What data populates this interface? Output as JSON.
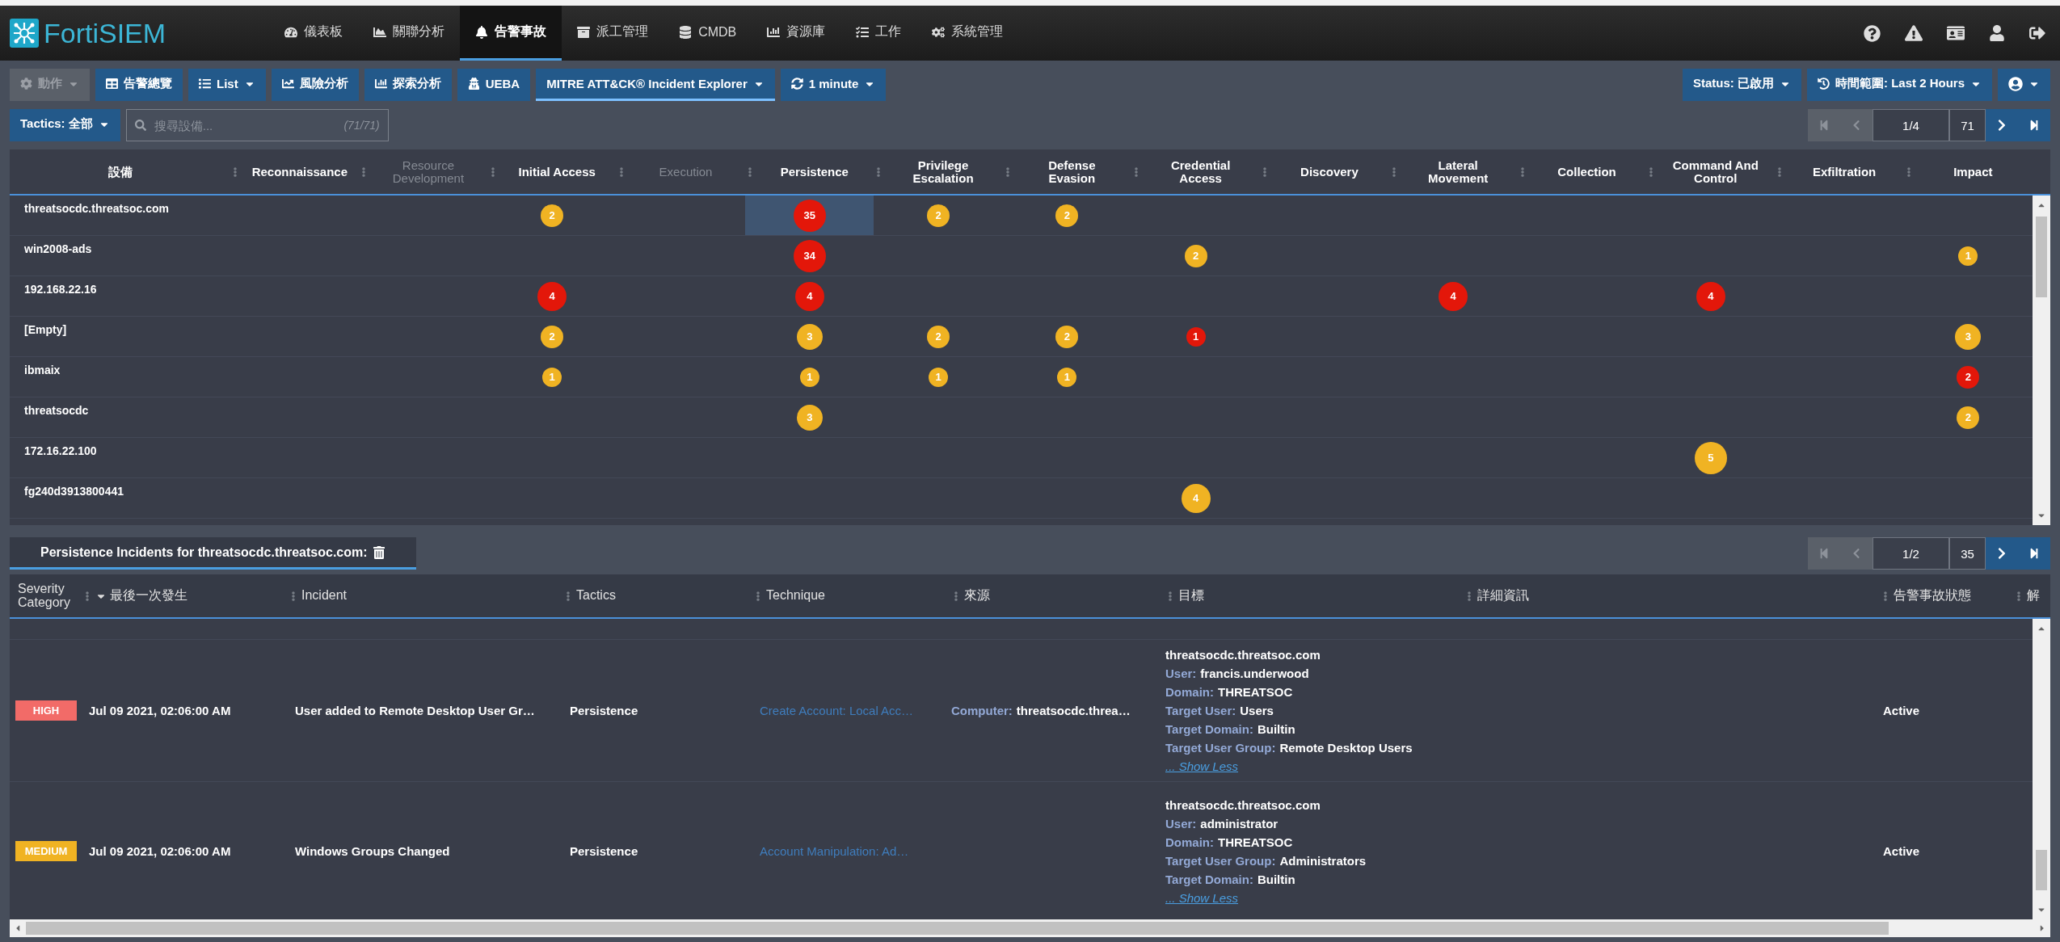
{
  "brand": "FortiSIEM",
  "nav": {
    "items": [
      {
        "label": "儀表板",
        "selected": false
      },
      {
        "label": "關聯分析",
        "selected": false
      },
      {
        "label": "告警事故",
        "selected": true
      },
      {
        "label": "派工管理",
        "selected": false
      },
      {
        "label": "CMDB",
        "selected": false
      },
      {
        "label": "資源庫",
        "selected": false
      },
      {
        "label": "工作",
        "selected": false
      },
      {
        "label": "系統管理",
        "selected": false
      }
    ]
  },
  "toolbar": {
    "left": [
      {
        "label": "動作",
        "caret": true,
        "disabled": true,
        "selected": false
      },
      {
        "label": "告警總覽",
        "caret": false,
        "disabled": false,
        "selected": false
      },
      {
        "label": "List",
        "caret": true,
        "disabled": false,
        "selected": false
      },
      {
        "label": "風險分析",
        "caret": false,
        "disabled": false,
        "selected": false
      },
      {
        "label": "探索分析",
        "caret": false,
        "disabled": false,
        "selected": false
      },
      {
        "label": "UEBA",
        "caret": false,
        "disabled": false,
        "selected": false
      },
      {
        "label": "MITRE ATT&CK® Incident Explorer",
        "caret": true,
        "disabled": false,
        "selected": true
      },
      {
        "label": "1 minute",
        "caret": true,
        "disabled": false,
        "selected": false
      }
    ],
    "right": [
      {
        "label": "Status: 已啟用",
        "caret": true
      },
      {
        "label": "時間範圍: Last 2 Hours",
        "caret": true
      },
      {
        "caret": true
      }
    ]
  },
  "filter": {
    "tactics": {
      "label": "Tactics: 全部",
      "caret": true
    },
    "search": {
      "placeholder": "搜尋設備...",
      "count": "(71/71)"
    }
  },
  "matrix_pager": {
    "page": "1/4",
    "size": "71",
    "at_start": true,
    "at_end": false
  },
  "matrix": {
    "device_column": {
      "label": "設備"
    },
    "columns": [
      {
        "label": "Reconnaissance",
        "disabled": false
      },
      {
        "label": "Resource Development",
        "disabled": true
      },
      {
        "label": "Initial Access",
        "disabled": false
      },
      {
        "label": "Execution",
        "disabled": true
      },
      {
        "label": "Persistence",
        "disabled": false
      },
      {
        "label": "Privilege Escalation",
        "disabled": false
      },
      {
        "label": "Defense Evasion",
        "disabled": false
      },
      {
        "label": "Credential Access",
        "disabled": false
      },
      {
        "label": "Discovery",
        "disabled": false
      },
      {
        "label": "Lateral Movement",
        "disabled": false
      },
      {
        "label": "Collection",
        "disabled": false
      },
      {
        "label": "Command And Control",
        "disabled": false
      },
      {
        "label": "Exfiltration",
        "disabled": false
      },
      {
        "label": "Impact",
        "disabled": false
      }
    ],
    "rows": [
      {
        "device": "threatsocdc.threatsoc.com",
        "cells": [
          null,
          null,
          {
            "count": "2",
            "color": "#f0b323",
            "selected": false
          },
          null,
          {
            "count": "35",
            "color": "#e3170a",
            "selected": true
          },
          {
            "count": "2",
            "color": "#f0b323",
            "selected": false
          },
          {
            "count": "2",
            "color": "#f0b323",
            "selected": false
          },
          null,
          null,
          null,
          null,
          null,
          null,
          null
        ]
      },
      {
        "device": "win2008-ads",
        "cells": [
          null,
          null,
          null,
          null,
          {
            "count": "34",
            "color": "#e3170a",
            "selected": false
          },
          null,
          null,
          {
            "count": "2",
            "color": "#f0b323",
            "selected": false
          },
          null,
          null,
          null,
          null,
          null,
          {
            "count": "1",
            "color": "#f0b323",
            "selected": false
          }
        ]
      },
      {
        "device": "192.168.22.16",
        "cells": [
          null,
          null,
          {
            "count": "4",
            "color": "#e3170a",
            "selected": false
          },
          null,
          {
            "count": "4",
            "color": "#e3170a",
            "selected": false
          },
          null,
          null,
          null,
          null,
          {
            "count": "4",
            "color": "#e3170a",
            "selected": false
          },
          null,
          {
            "count": "4",
            "color": "#e3170a",
            "selected": false
          },
          null,
          null
        ]
      },
      {
        "device": "[Empty]",
        "cells": [
          null,
          null,
          {
            "count": "2",
            "color": "#f0b323",
            "selected": false
          },
          null,
          {
            "count": "3",
            "color": "#f0b323",
            "selected": false
          },
          {
            "count": "2",
            "color": "#f0b323",
            "selected": false
          },
          {
            "count": "2",
            "color": "#f0b323",
            "selected": false
          },
          {
            "count": "1",
            "color": "#e3170a",
            "selected": false
          },
          null,
          null,
          null,
          null,
          null,
          {
            "count": "3",
            "color": "#f0b323",
            "selected": false
          }
        ]
      },
      {
        "device": "ibmaix",
        "cells": [
          null,
          null,
          {
            "count": "1",
            "color": "#f0b323",
            "selected": false
          },
          null,
          {
            "count": "1",
            "color": "#f0b323",
            "selected": false
          },
          {
            "count": "1",
            "color": "#f0b323",
            "selected": false
          },
          {
            "count": "1",
            "color": "#f0b323",
            "selected": false
          },
          null,
          null,
          null,
          null,
          null,
          null,
          {
            "count": "2",
            "color": "#e3170a",
            "selected": false
          }
        ]
      },
      {
        "device": "threatsocdc",
        "cells": [
          null,
          null,
          null,
          null,
          {
            "count": "3",
            "color": "#f0b323",
            "selected": false
          },
          null,
          null,
          null,
          null,
          null,
          null,
          null,
          null,
          {
            "count": "2",
            "color": "#f0b323",
            "selected": false
          }
        ]
      },
      {
        "device": "172.16.22.100",
        "cells": [
          null,
          null,
          null,
          null,
          null,
          null,
          null,
          null,
          null,
          null,
          null,
          {
            "count": "5",
            "color": "#f0b323",
            "selected": false
          },
          null,
          null
        ]
      },
      {
        "device": "fg240d3913800441",
        "cells": [
          null,
          null,
          null,
          null,
          null,
          null,
          null,
          {
            "count": "4",
            "color": "#f0b323",
            "selected": false
          },
          null,
          null,
          null,
          null,
          null,
          null
        ]
      }
    ]
  },
  "incidents": {
    "tab": {
      "label": "Persistence Incidents for threatsocdc.threatsoc.com:",
      "selected": true
    },
    "pager": {
      "page": "1/2",
      "size": "35",
      "at_start": true,
      "at_end": false
    },
    "columns": [
      {
        "label": "Severity Category",
        "sorted": false
      },
      {
        "label": "最後一次發生",
        "sorted": true
      },
      {
        "label": "Incident",
        "sorted": false
      },
      {
        "label": "Tactics",
        "sorted": false
      },
      {
        "label": "Technique",
        "sorted": false
      },
      {
        "label": "來源",
        "sorted": false
      },
      {
        "label": "目標",
        "sorted": false
      },
      {
        "label": "詳細資訊",
        "sorted": false
      },
      {
        "label": "告警事故狀態",
        "sorted": false
      },
      {
        "label": "解",
        "sorted": false
      }
    ],
    "rows": [
      {
        "severity": {
          "label": "HIGH",
          "color": "#f26b68"
        },
        "last_seen": "Jul 09 2021, 02:06:00 AM",
        "incident": "User added to Remote Desktop User Gr…",
        "tactic": "Persistence",
        "technique": "Create Account: Local Acc…",
        "source": [
          {
            "key": "Computer:",
            "value": "threatsocdc.threa…"
          }
        ],
        "target": {
          "host": "threatsocdc.threatsoc.com",
          "fields": [
            {
              "key": "User:",
              "value": "francis.underwood"
            },
            {
              "key": "Domain:",
              "value": "THREATSOC"
            },
            {
              "key": "Target User:",
              "value": "Users"
            },
            {
              "key": "Target Domain:",
              "value": "Builtin"
            },
            {
              "key": "Target User Group:",
              "value": "Remote Desktop Users"
            }
          ],
          "toggle": "... Show Less"
        },
        "status": "Active"
      },
      {
        "severity": {
          "label": "MEDIUM",
          "color": "#f0b323"
        },
        "last_seen": "Jul 09 2021, 02:06:00 AM",
        "incident": "Windows Groups Changed",
        "tactic": "Persistence",
        "technique": "Account Manipulation: Ad…",
        "target": {
          "host": "threatsocdc.threatsoc.com",
          "fields": [
            {
              "key": "User:",
              "value": "administrator"
            },
            {
              "key": "Domain:",
              "value": "THREATSOC"
            },
            {
              "key": "Target User Group:",
              "value": "Administrators"
            },
            {
              "key": "Target Domain:",
              "value": "Builtin"
            }
          ],
          "toggle": "... Show Less"
        },
        "status": "Active"
      }
    ]
  }
}
